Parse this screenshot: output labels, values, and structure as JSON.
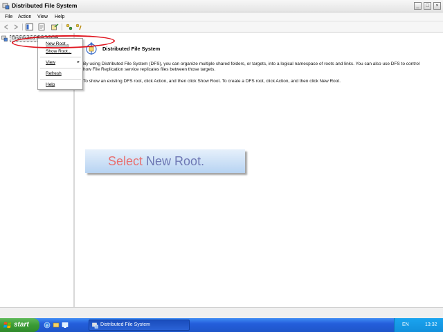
{
  "window": {
    "title": "Distributed File System",
    "minimize_glyph": "_",
    "maximize_glyph": "□",
    "close_glyph": "×"
  },
  "menubar": {
    "file": "File",
    "action": "Action",
    "view": "View",
    "help": "Help"
  },
  "toolbar": {
    "icons": [
      "back-arrow-icon",
      "forward-arrow-icon",
      "show-hide-tree-icon",
      "properties-icon",
      "export-list-icon",
      "refresh-icon",
      "help-icon"
    ]
  },
  "tree": {
    "root_label": "Distributed File System"
  },
  "context_menu": {
    "items": [
      {
        "label": "New Root..."
      },
      {
        "label": "Show Root..."
      },
      {
        "label": "View",
        "arrow": "▸"
      },
      {
        "label": "Refresh"
      },
      {
        "label": "Help"
      }
    ]
  },
  "content": {
    "title": "Distributed File System",
    "paragraph1": "By using Distributed File System (DFS), you can organize multiple shared folders, or targets, into a logical namespace of roots and links. You can also use DFS to control how File Replication service replicates files between those targets.",
    "paragraph2": "To show an existing DFS root, click Action, and then click Show Root. To create a DFS root, click Action, and then click New Root."
  },
  "callout": {
    "word_select": "Select",
    "rest": " New Root."
  },
  "taskbar": {
    "start_label": "start",
    "task_label": "Distributed File System",
    "language": "EN",
    "clock": "13:32"
  },
  "colors": {
    "highlight_ellipse": "#e0151f",
    "taskbar_blue": "#245edb",
    "start_green": "#3b9b35",
    "callout_select": "#e87070",
    "callout_rest": "#6e78b4"
  }
}
